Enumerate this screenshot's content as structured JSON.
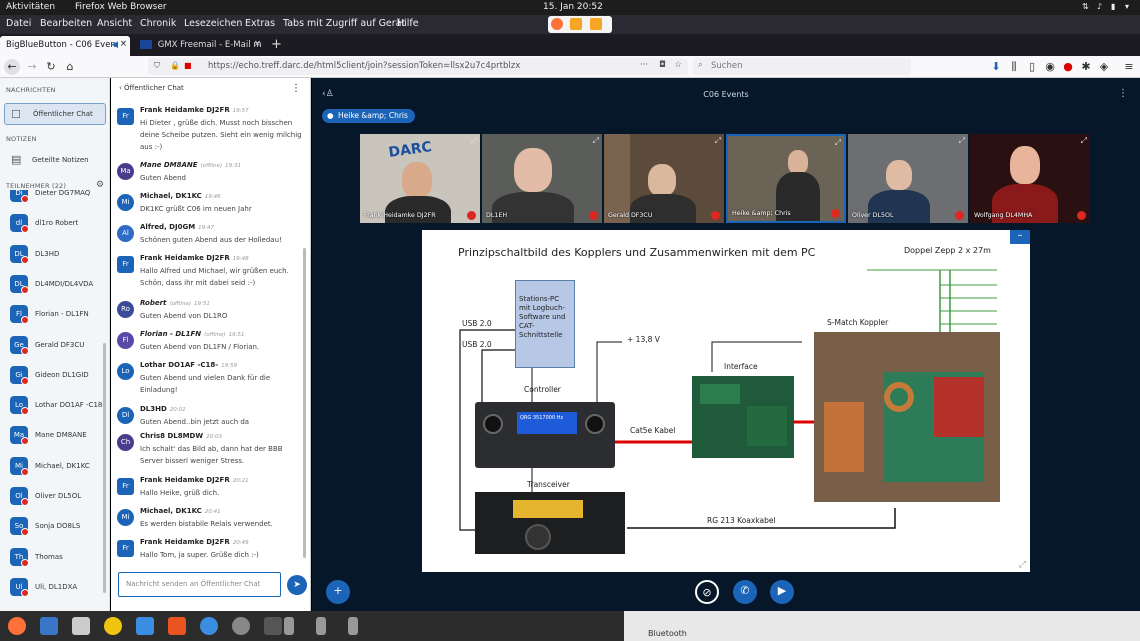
{
  "system": {
    "activities": "Aktivitäten",
    "app": "Firefox Web Browser",
    "clock": "15. Jan  20:52"
  },
  "menu": [
    "Datei",
    "Bearbeiten",
    "Ansicht",
    "Chronik",
    "Lesezeichen",
    "Extras",
    "Tabs mit Zugriff auf Gerät",
    "Hilfe"
  ],
  "tabs": [
    {
      "label": "BigBlueButton - C06 Even"
    },
    {
      "label": "GMX Freemail - E-Mail m"
    }
  ],
  "url": "https://echo.treff.darc.de/html5client/join?sessionToken=llsx2u7c4prtblzx",
  "search_placeholder": "Suchen",
  "sidebar": {
    "messages_head": "NACHRICHTEN",
    "public_chat": "Öffentlicher Chat",
    "notes_head": "NOTIZEN",
    "shared_notes": "Geteilte Notizen",
    "participants_head": "TEILNEHMER (22)",
    "participants": [
      {
        "initials": "Di",
        "name": "Dieter DG7MAQ"
      },
      {
        "initials": "dl",
        "name": "dl1ro Robert"
      },
      {
        "initials": "DL",
        "name": "DL3HD"
      },
      {
        "initials": "DL",
        "name": "DL4MDI/DL4VDA"
      },
      {
        "initials": "Fl",
        "name": "Florian - DL1FN"
      },
      {
        "initials": "Ge",
        "name": "Gerald DF3CU"
      },
      {
        "initials": "Gi",
        "name": "Gideon DL1GID"
      },
      {
        "initials": "Lo",
        "name": "Lothar DO1AF -C18-"
      },
      {
        "initials": "Ma",
        "name": "Mane DM8ANE"
      },
      {
        "initials": "Mi",
        "name": "Michael, DK1KC"
      },
      {
        "initials": "Ol",
        "name": "Oliver DL5OL"
      },
      {
        "initials": "So",
        "name": "Sonja DO8LS"
      },
      {
        "initials": "Th",
        "name": "Thomas"
      },
      {
        "initials": "Ul",
        "name": "Uli, DL1DXA"
      }
    ]
  },
  "chat": {
    "header": "Öffentlicher Chat",
    "input_placeholder": "Nachricht senden an Öffentlicher Chat",
    "messages": [
      {
        "initials": "Fr",
        "name": "Frank Heidamke DJ2FR",
        "time": "19:57",
        "text": "Hi Dieter , grüße dich. Musst noch bisschen deine Scheibe putzen. Sieht ein wenig milchig aus :-)"
      },
      {
        "initials": "Ma",
        "name": "Mane DM8ANE",
        "status": "(offline)",
        "time": "19:31",
        "text": "Guten Abend"
      },
      {
        "initials": "Mi",
        "name": "Michael, DK1KC",
        "time": "19:46",
        "text": "DK1KC grüßt C06 im neuen Jahr"
      },
      {
        "initials": "Al",
        "name": "Alfred, DJ0GM",
        "time": "19:47",
        "text": "Schönen guten Abend aus der Holledau!"
      },
      {
        "initials": "Fr",
        "name": "Frank Heidamke DJ2FR",
        "time": "19:48",
        "text": "Hallo Alfred und Michael, wir grüßen euch. Schön, dass ihr mit dabei seid :-)"
      },
      {
        "initials": "Ro",
        "name": "Robert",
        "status": "(offline)",
        "time": "19:51",
        "text": "Guten Abend von DL1RO"
      },
      {
        "initials": "Fl",
        "name": "Florian - DL1FN",
        "status": "(offline)",
        "time": "19:51",
        "text": "Guten Abend von DL1FN / Florian."
      },
      {
        "initials": "Lo",
        "name": "Lothar DO1AF -C18-",
        "time": "19:59",
        "text": "Guten Abend und vielen Dank für die Einladung!"
      },
      {
        "initials": "Dl",
        "name": "DL3HD",
        "time": "20:02",
        "text": "Guten Abend..bin jetzt auch da"
      },
      {
        "initials": "Ch",
        "name": "Chris8 DL8MDW",
        "time": "20:03",
        "text": "Ich schalt' das Bild ab, dann hat der BBB Server bisserl weniger Stress."
      },
      {
        "initials": "Fr",
        "name": "Frank Heidamke DJ2FR",
        "time": "20:21",
        "text": "Hallo Heike, grüß dich."
      },
      {
        "initials": "Mi",
        "name": "Michael, DK1KC",
        "time": "20:41",
        "text": "Es werden bistabile Relais verwendet."
      },
      {
        "initials": "Fr",
        "name": "Frank Heidamke DJ2FR",
        "time": "20:49",
        "text": "Hallo Tom, ja super. Grüße dich :-)"
      }
    ]
  },
  "meeting": {
    "title": "C06 Events",
    "talking": "Heike &amp; Chris",
    "videos": [
      {
        "name": "Frank Heidamke DJ2FR"
      },
      {
        "name": "DL1EH"
      },
      {
        "name": "Gerald DF3CU"
      },
      {
        "name": "Heike &amp; Chris"
      },
      {
        "name": "Oliver DL5OL"
      },
      {
        "name": "Wolfgang DL4MHA"
      }
    ],
    "slide": {
      "title": "Prinzipschaltbild des Kopplers und Zusammenwirken mit dem PC",
      "antenna": "Doppel Zepp 2 x 27m",
      "pc": "Stations-PC mit Logbuch-Software und CAT-Schnittstelle",
      "usb1": "USB 2.0",
      "usb2": "USB 2.0",
      "power": "+ 13,8 V",
      "controller": "Controller",
      "interface": "Interface",
      "coupler": "S-Match Koppler",
      "cat5": "Cat5e Kabel",
      "transceiver": "Transceiver",
      "coax": "RG 213 Koaxkabel",
      "lcd": "QRG 3517000 Hz"
    }
  },
  "colors": {
    "bbb_blue": "#1b64b8",
    "dark_bg": "#06172a",
    "mic_red": "#df2721"
  }
}
